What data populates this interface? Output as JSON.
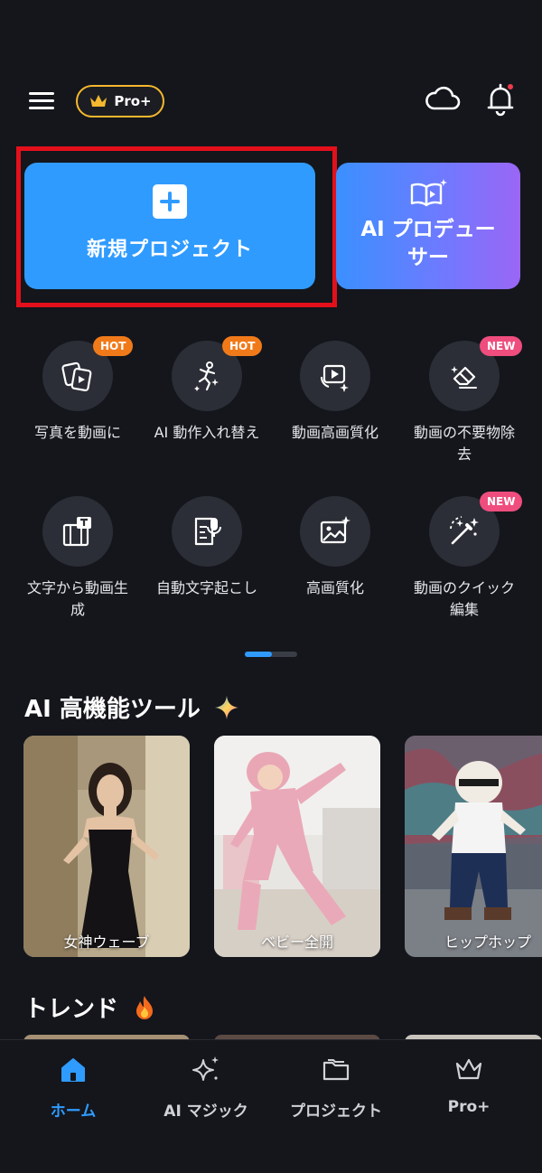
{
  "header": {
    "menu_icon": "hamburger-menu-icon",
    "pro_badge_label": "Pro+",
    "cloud_icon": "cloud-icon",
    "bell_icon": "bell-icon"
  },
  "primary_actions": {
    "new_project_label": "新規プロジェクト",
    "ai_producer_label": "AI プロデューサー"
  },
  "tools": [
    {
      "label": "写真を動画に",
      "badge": "HOT",
      "icon": "photo-to-video-icon"
    },
    {
      "label": "AI 動作入れ替え",
      "badge": "HOT",
      "icon": "dance-swap-icon"
    },
    {
      "label": "動画高画質化",
      "badge": "",
      "icon": "video-enhance-icon"
    },
    {
      "label": "動画の不要物除去",
      "badge": "NEW",
      "icon": "eraser-icon"
    },
    {
      "label": "文字から動画生成",
      "badge": "",
      "icon": "text-to-video-icon"
    },
    {
      "label": "自動文字起こし",
      "badge": "",
      "icon": "transcribe-icon"
    },
    {
      "label": "高画質化",
      "badge": "",
      "icon": "image-enhance-icon"
    },
    {
      "label": "動画のクイック編集",
      "badge": "NEW",
      "icon": "magic-wand-icon"
    }
  ],
  "ai_tools_section": {
    "title": "AI 高機能ツール",
    "items": [
      {
        "caption": "女神ウェーブ"
      },
      {
        "caption": "ベビー全開"
      },
      {
        "caption": "ヒップホップ"
      }
    ]
  },
  "trend_section": {
    "title": "トレンド"
  },
  "bottom_nav": [
    {
      "label": "ホーム",
      "icon": "home-icon",
      "active": true
    },
    {
      "label": "AI マジック",
      "icon": "sparkle-icon",
      "active": false
    },
    {
      "label": "プロジェクト",
      "icon": "folder-icon",
      "active": false
    },
    {
      "label": "Pro+",
      "icon": "crown-icon",
      "active": false
    }
  ],
  "colors": {
    "background": "#14161c",
    "accent": "#2f9bff",
    "highlight_frame": "#e3101b",
    "hot_badge": "#f07a1a",
    "new_badge": "#ef4d7e",
    "pro_gold": "#f5b82e"
  }
}
